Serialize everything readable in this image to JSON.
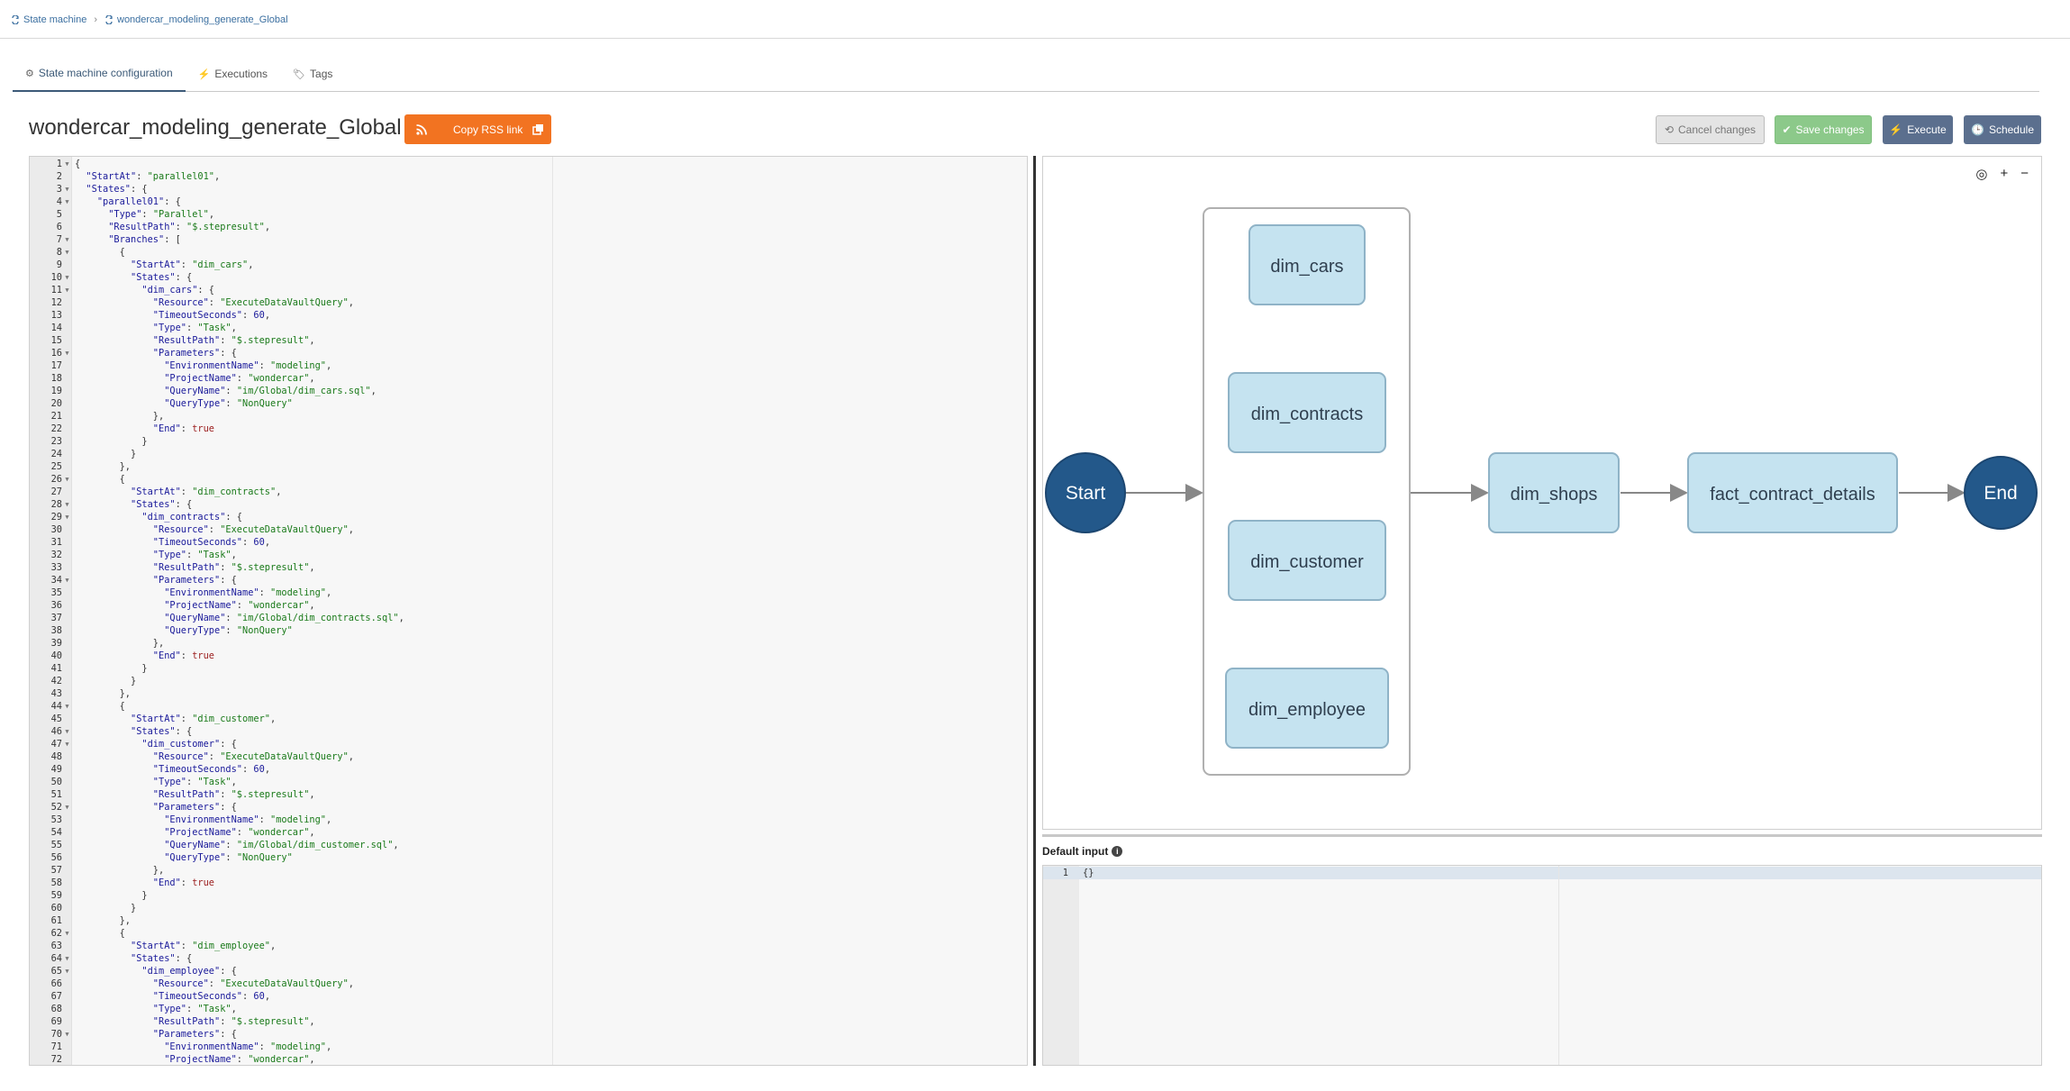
{
  "breadcrumb": {
    "root": "State machine",
    "current": "wondercar_modeling_generate_Global"
  },
  "tabs": [
    {
      "label": "State machine configuration",
      "icon": "gear-icon"
    },
    {
      "label": "Executions",
      "icon": "bolt-icon"
    },
    {
      "label": "Tags",
      "icon": "tag-icon"
    }
  ],
  "title": "wondercar_modeling_generate_Global",
  "rss_button": {
    "label": "Copy RSS link"
  },
  "actions": {
    "cancel": "Cancel changes",
    "save": "Save changes",
    "execute": "Execute",
    "schedule": "Schedule"
  },
  "colors": {
    "rss": "#f27321",
    "save": "#8cc98a",
    "execute": "#5b6f8e",
    "node_fill": "#c5e3f0",
    "node_stroke": "#8fb3c7",
    "terminal": "#23588a"
  },
  "editor_lines": [
    "{",
    "  \"StartAt\": \"parallel01\",",
    "  \"States\": {",
    "    \"parallel01\": {",
    "      \"Type\": \"Parallel\",",
    "      \"ResultPath\": \"$.stepresult\",",
    "      \"Branches\": [",
    "        {",
    "          \"StartAt\": \"dim_cars\",",
    "          \"States\": {",
    "            \"dim_cars\": {",
    "              \"Resource\": \"ExecuteDataVaultQuery\",",
    "              \"TimeoutSeconds\": 60,",
    "              \"Type\": \"Task\",",
    "              \"ResultPath\": \"$.stepresult\",",
    "              \"Parameters\": {",
    "                \"EnvironmentName\": \"modeling\",",
    "                \"ProjectName\": \"wondercar\",",
    "                \"QueryName\": \"im/Global/dim_cars.sql\",",
    "                \"QueryType\": \"NonQuery\"",
    "              },",
    "              \"End\": true",
    "            }",
    "          }",
    "        },",
    "        {",
    "          \"StartAt\": \"dim_contracts\",",
    "          \"States\": {",
    "            \"dim_contracts\": {",
    "              \"Resource\": \"ExecuteDataVaultQuery\",",
    "              \"TimeoutSeconds\": 60,",
    "              \"Type\": \"Task\",",
    "              \"ResultPath\": \"$.stepresult\",",
    "              \"Parameters\": {",
    "                \"EnvironmentName\": \"modeling\",",
    "                \"ProjectName\": \"wondercar\",",
    "                \"QueryName\": \"im/Global/dim_contracts.sql\",",
    "                \"QueryType\": \"NonQuery\"",
    "              },",
    "              \"End\": true",
    "            }",
    "          }",
    "        },",
    "        {",
    "          \"StartAt\": \"dim_customer\",",
    "          \"States\": {",
    "            \"dim_customer\": {",
    "              \"Resource\": \"ExecuteDataVaultQuery\",",
    "              \"TimeoutSeconds\": 60,",
    "              \"Type\": \"Task\",",
    "              \"ResultPath\": \"$.stepresult\",",
    "              \"Parameters\": {",
    "                \"EnvironmentName\": \"modeling\",",
    "                \"ProjectName\": \"wondercar\",",
    "                \"QueryName\": \"im/Global/dim_customer.sql\",",
    "                \"QueryType\": \"NonQuery\"",
    "              },",
    "              \"End\": true",
    "            }",
    "          }",
    "        },",
    "        {",
    "          \"StartAt\": \"dim_employee\",",
    "          \"States\": {",
    "            \"dim_employee\": {",
    "              \"Resource\": \"ExecuteDataVaultQuery\",",
    "              \"TimeoutSeconds\": 60,",
    "              \"Type\": \"Task\",",
    "              \"ResultPath\": \"$.stepresult\",",
    "              \"Parameters\": {",
    "                \"EnvironmentName\": \"modeling\",",
    "                \"ProjectName\": \"wondercar\","
  ],
  "fold_lines": [
    1,
    3,
    4,
    7,
    8,
    10,
    11,
    16,
    26,
    28,
    29,
    34,
    44,
    46,
    47,
    52,
    62,
    64,
    65,
    70
  ],
  "graph": {
    "start_label": "Start",
    "end_label": "End",
    "parallel_branches": [
      "dim_cars",
      "dim_contracts",
      "dim_customer",
      "dim_employee"
    ],
    "sequence": [
      "dim_shops",
      "fact_contract_details"
    ],
    "toolbar": {
      "fit": "◎",
      "zoom_in": "+",
      "zoom_out": "−"
    }
  },
  "default_input": {
    "label": "Default input",
    "line_number": "1",
    "value": "{}"
  }
}
